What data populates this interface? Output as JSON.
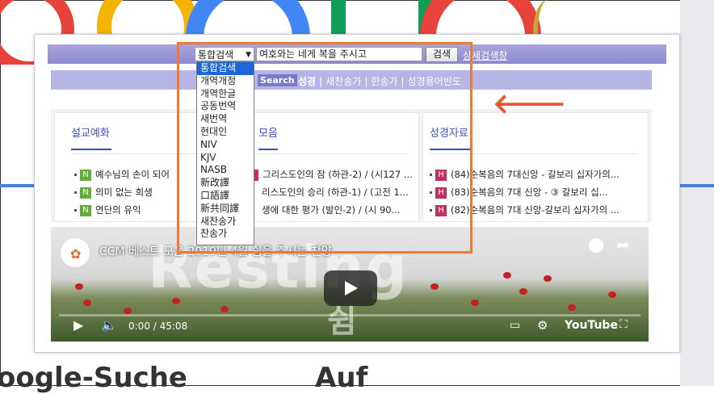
{
  "search_bar": {
    "select_value": "통합검색",
    "query_value": "여호와는 네게 복을 주시고",
    "search_button": "검색",
    "detail_link": "상세검색창"
  },
  "dropdown_options": [
    "통합검색",
    "개역개정",
    "개역한글",
    "공동번역",
    "새번역",
    "현대인",
    "NIV",
    "KJV",
    "NASB",
    "新改譯",
    "口語譯",
    "新共同譯",
    "새찬송가",
    "찬송가"
  ],
  "subnav": {
    "badge": "Search",
    "items": [
      "성경",
      "새찬송가",
      "한송가",
      "성경용어빈도"
    ]
  },
  "panels": [
    {
      "title": "설교예화",
      "items": [
        {
          "badge": "N",
          "text": "예수님의 손이 되어"
        },
        {
          "badge": "N",
          "text": "의미 없는 희생"
        },
        {
          "badge": "N",
          "text": "연단의 유익"
        }
      ]
    },
    {
      "title": "모음",
      "items": [
        {
          "badge": "H",
          "text": "그리스도인의 잠 (하관-2) / (시127 ..."
        },
        {
          "badge": "",
          "text": "리스도인의 승리 (하관-1) / (고전 1..."
        },
        {
          "badge": "",
          "text": "생에 대한 평가 (발인-2) / (시 90..."
        }
      ]
    },
    {
      "title": "성경자료",
      "items": [
        {
          "badge": "H",
          "text": "(84)순복음의 7대신앙 - 갈보리 십자가의..."
        },
        {
          "badge": "H",
          "text": "(83)순복음의 7대 신앙 - ③ 갈보리 십..."
        },
        {
          "badge": "H",
          "text": "(82)순복음의 7대 신앙-갈보리 십자가의 ..."
        }
      ]
    }
  ],
  "video": {
    "title": "CCM 베스트 모음 2019년 4월 쉼을 주시는 찬양",
    "overlay_big": "Resting",
    "overlay_small": "쉼",
    "time": "0:00 / 45:08",
    "brand": "YouTube",
    "progress": 0
  },
  "background": {
    "left_text": "oogle-Suche",
    "right_text": "Auf"
  },
  "colors": {
    "accent_orange": "#f07a35",
    "nav_purple": "#8e8ad0",
    "link_blue": "#3850b8",
    "badge_green": "#5fae3a",
    "badge_red": "#c3305e"
  }
}
